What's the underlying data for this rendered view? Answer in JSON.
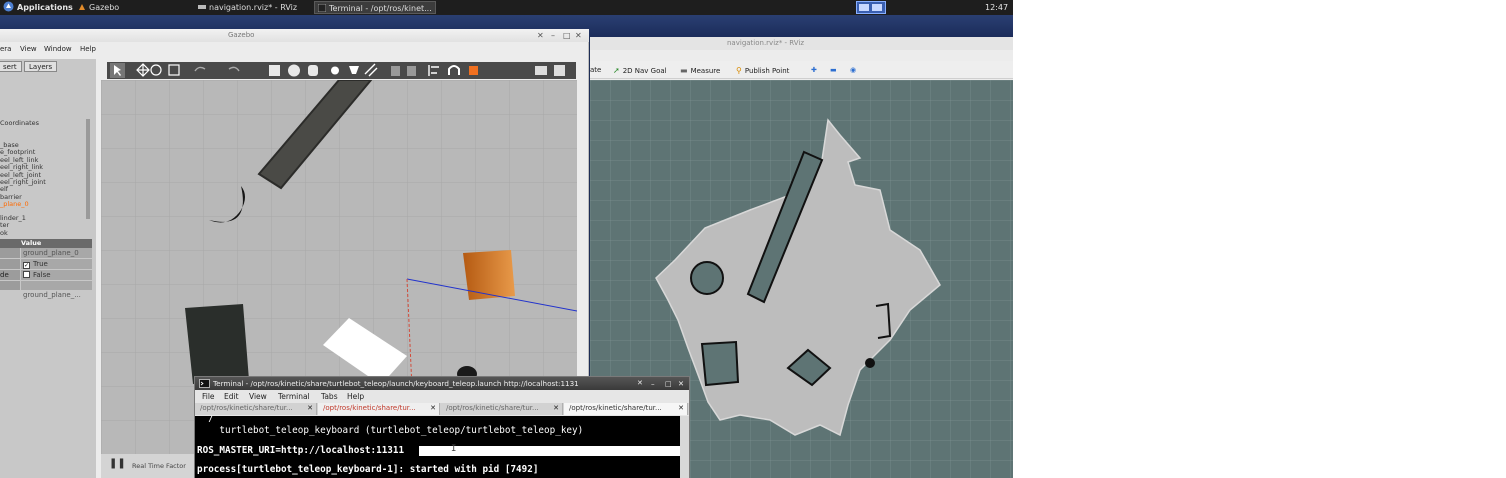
{
  "top_panel": {
    "applications": "Applications",
    "tasks": [
      {
        "label": "Gazebo",
        "active": false
      },
      {
        "label": "navigation.rviz* - RViz",
        "active": false
      },
      {
        "label": "Terminal - /opt/ros/kinet...",
        "active": true
      }
    ],
    "clock": "12:47"
  },
  "rviz": {
    "title": "navigation.rviz* - RViz",
    "tools": [
      "ate",
      "2D Nav Goal",
      "Measure",
      "Publish Point"
    ]
  },
  "gazebo": {
    "title": "Gazebo",
    "menu": [
      "era",
      "View",
      "Window",
      "Help"
    ],
    "tabs": [
      "sert",
      "Layers"
    ],
    "tree": [
      "Coordinates",
      "_base",
      "e_footprint",
      "eel_left_link",
      "eel_right_link",
      "eel_left_joint",
      "eel_right_joint",
      "elf",
      "barrier",
      "_plane_0",
      "linder_1",
      "ter",
      "ok"
    ],
    "prop_header": "Value",
    "props": [
      {
        "key": "",
        "value": "ground_plane_0",
        "check": false
      },
      {
        "key": "",
        "value": "True",
        "check": true,
        "checked": true
      },
      {
        "key": "de",
        "value": "False",
        "check": true,
        "checked": false
      },
      {
        "key": "",
        "value": "",
        "check": false
      },
      {
        "key": "",
        "value": "ground_plane_...",
        "check": false
      }
    ],
    "realtime_label": "Real Time Factor"
  },
  "terminal": {
    "title": "Terminal - /opt/ros/kinetic/share/turtlebot_teleop/launch/keyboard_teleop.launch http://localhost:1131",
    "menu": [
      "File",
      "Edit",
      "View",
      "Terminal",
      "Tabs",
      "Help"
    ],
    "tabs": [
      "/opt/ros/kinetic/share/tur...",
      "/opt/ros/kinetic/share/tur...",
      "/opt/ros/kinetic/share/tur...",
      "/opt/ros/kinetic/share/tur..."
    ],
    "lines": [
      "  /",
      "    turtlebot_teleop_keyboard (turtlebot_teleop/turtlebot_teleop_key)",
      "ROS_MASTER_URI=http://localhost:11311",
      "process[turtlebot_teleop_keyboard-1]: started with pid [7492]"
    ]
  }
}
